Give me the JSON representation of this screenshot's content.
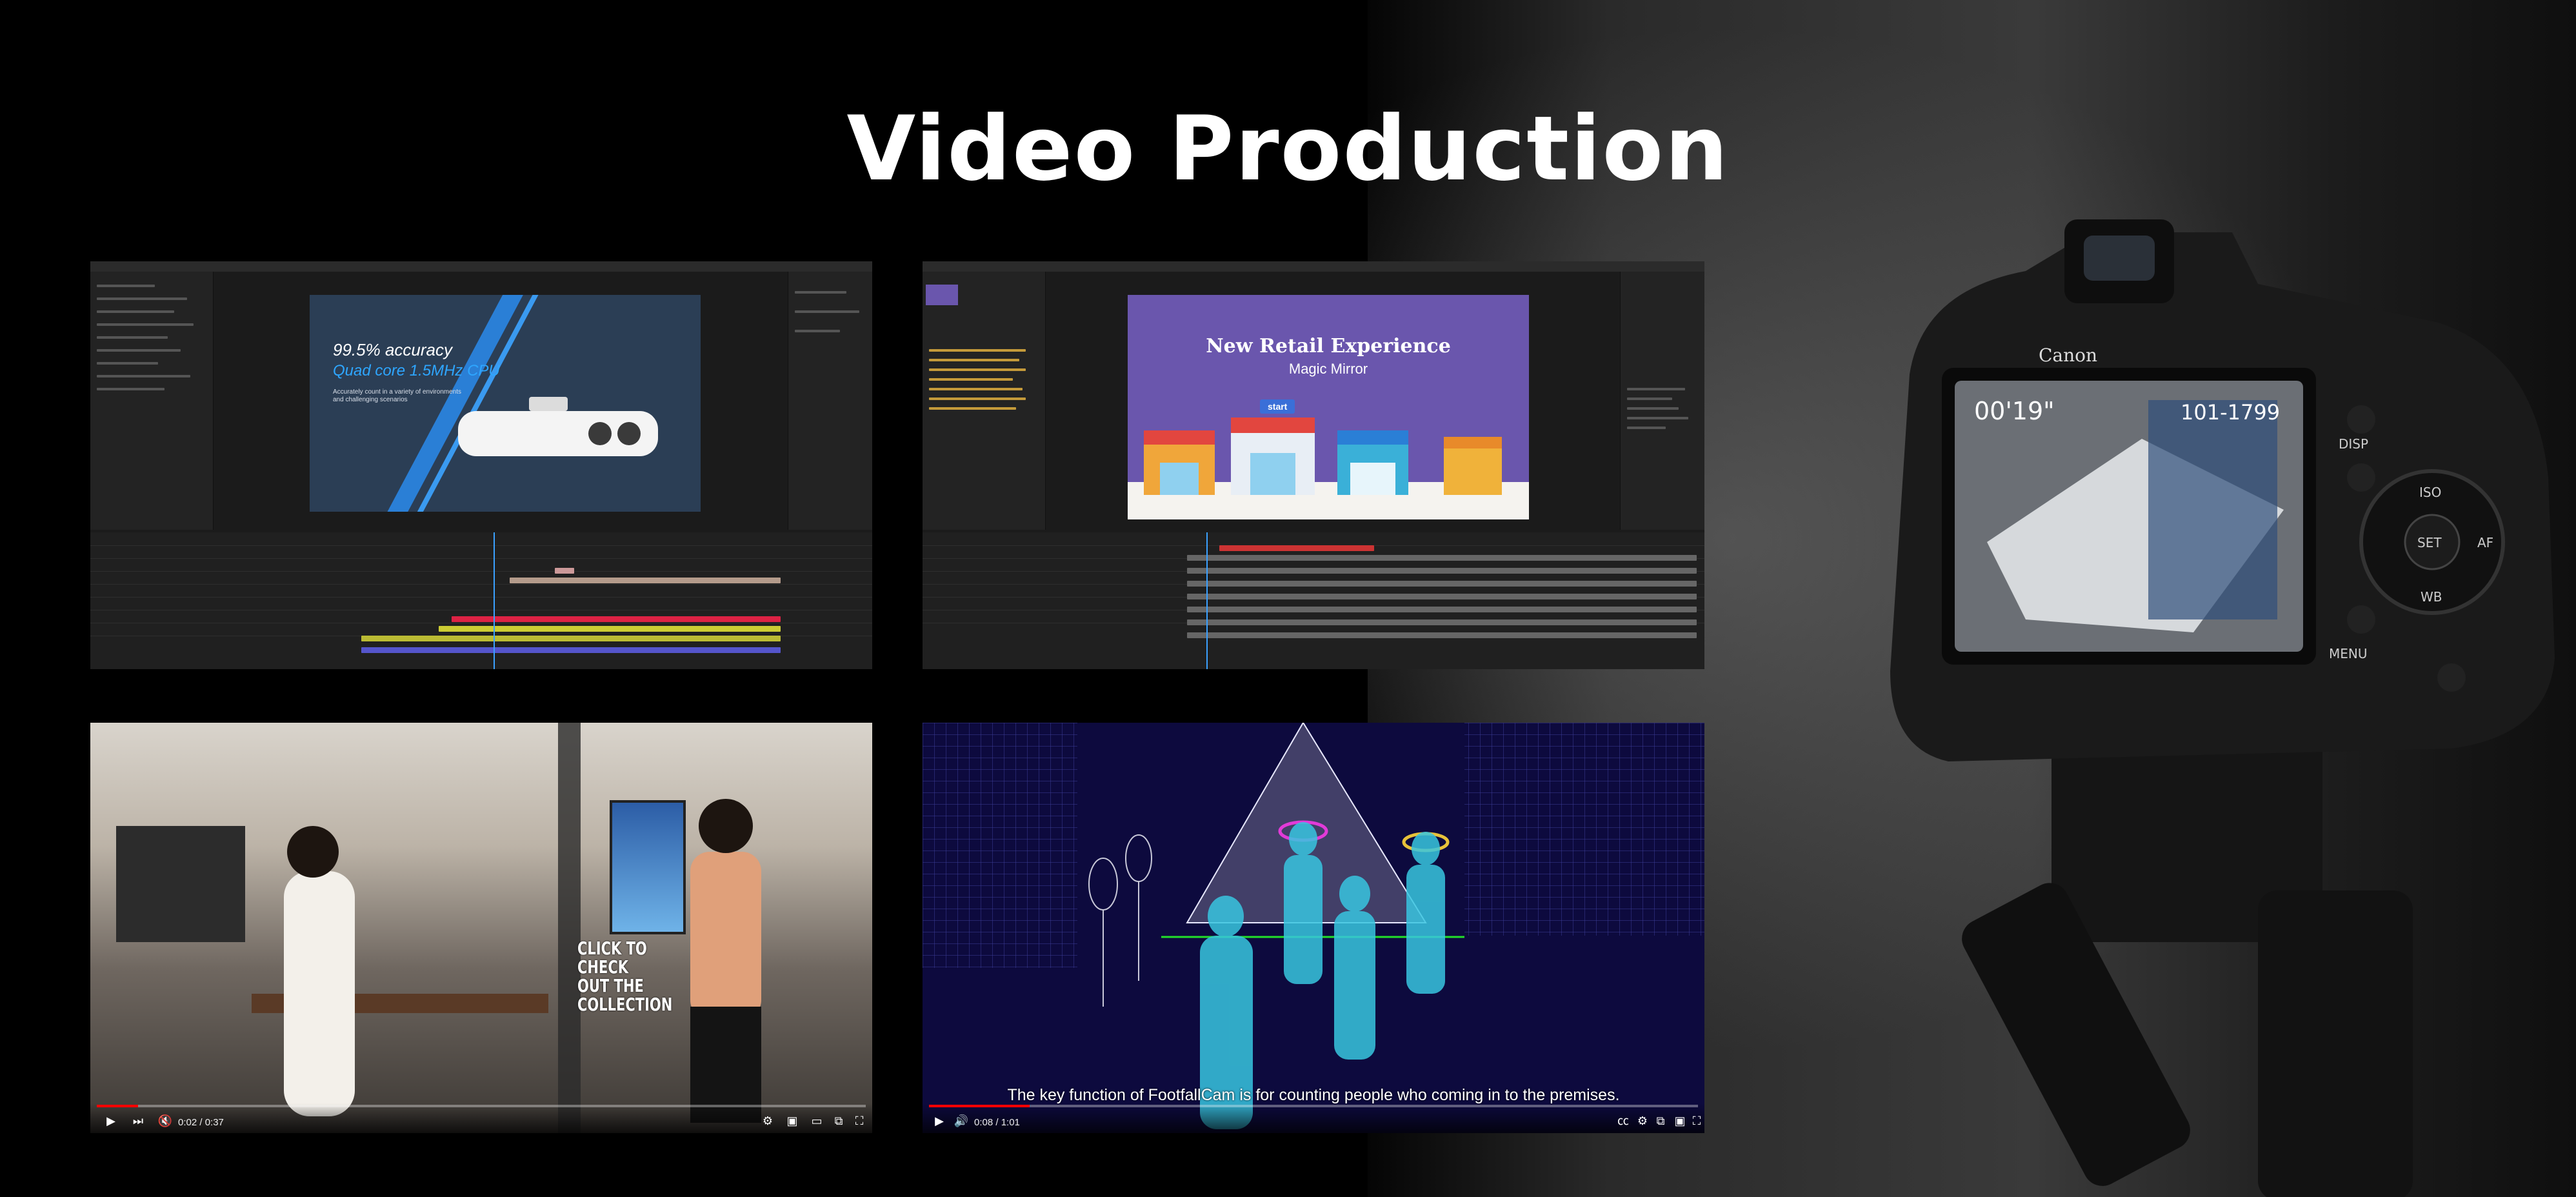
{
  "page": {
    "title": "Video Production"
  },
  "panels": {
    "ae_editor_1": {
      "comp_heading": "99.5% accuracy",
      "comp_subheading": "Quad core 1.5MHz CPU",
      "comp_note": "Accurately count in a variety of environments and challenging scenarios"
    },
    "ae_editor_2": {
      "comp_title": "New Retail Experience",
      "comp_subtitle": "Magic Mirror",
      "start_label": "start"
    },
    "video_player_1": {
      "overlay_text": "CLICK TO CHECK OUT THE COLLECTION",
      "time": "0:02 / 0:37",
      "progress": 0.054
    },
    "video_player_2": {
      "subtitle": "The key function of FootfallCam is for counting people who coming in to the premises.",
      "time": "0:08 / 1:01",
      "progress": 0.131
    }
  },
  "camera": {
    "brand": "Canon",
    "display_left": "00'19\"",
    "display_right": "101-1799",
    "buttons": [
      "DISP",
      "ISO",
      "SET",
      "AF",
      "WB",
      "MENU"
    ]
  },
  "colors": {
    "accent_red": "#ff0000",
    "ae_blue": "#2a7fd6",
    "comp_purple": "#6a56ad",
    "wireframe_cyan": "#38c6e0"
  }
}
